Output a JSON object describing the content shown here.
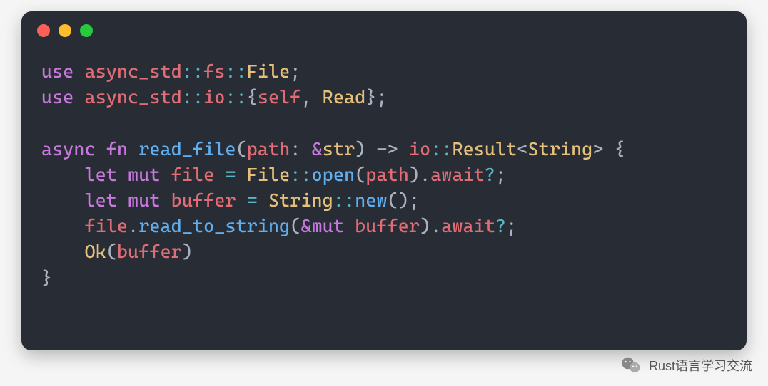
{
  "code": {
    "l1": {
      "use": "use",
      "ns1": "async_std",
      "sep1": "::",
      "ns2": "fs",
      "sep2": "::",
      "ty": "File",
      "semi": ";"
    },
    "l2": {
      "use": "use",
      "ns1": "async_std",
      "sep1": "::",
      "ns2": "io",
      "sep2": "::",
      "ob": "{",
      "self": "self",
      "comma": ", ",
      "ty": "Read",
      "cb": "}",
      "semi": ";"
    },
    "l4": {
      "async": "async",
      "fn": "fn",
      "name": "read_file",
      "op": "(",
      "param": "path",
      "colon": ": ",
      "amp": "&",
      "str": "str",
      "cp": ")",
      "arrow": " -> ",
      "ions": "io",
      "sep": "::",
      "res": "Result",
      "lt": "<",
      "string": "String",
      "gt": ">",
      "ob": " {"
    },
    "l5": {
      "indent": "    ",
      "let": "let",
      "mut": "mut",
      "var": "file",
      "eq": " = ",
      "ty": "File",
      "sep": "::",
      "open": "open",
      "op": "(",
      "arg": "path",
      "cp": ")",
      "dot": ".",
      "await": "await",
      "q": "?",
      "semi": ";"
    },
    "l6": {
      "indent": "    ",
      "let": "let",
      "mut": "mut",
      "var": "buffer",
      "eq": " = ",
      "ty": "String",
      "sep": "::",
      "new": "new",
      "parens": "()",
      "semi": ";"
    },
    "l7": {
      "indent": "    ",
      "recv": "file",
      "dot1": ".",
      "method": "read_to_string",
      "op": "(",
      "amp": "&",
      "mut": "mut",
      "sp": " ",
      "arg": "buffer",
      "cp": ")",
      "dot2": ".",
      "await": "await",
      "q": "?",
      "semi": ";"
    },
    "l8": {
      "indent": "    ",
      "ok": "Ok",
      "op": "(",
      "arg": "buffer",
      "cp": ")"
    },
    "l9": {
      "cb": "}"
    }
  },
  "watermark": {
    "text": "Rust语言学习交流"
  }
}
